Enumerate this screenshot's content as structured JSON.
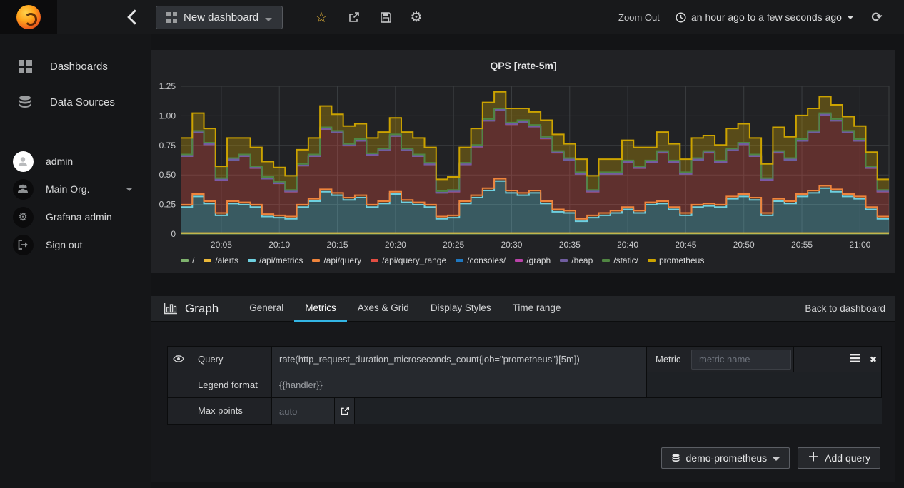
{
  "navbar": {
    "dashboard_title": "New dashboard",
    "zoom_out_label": "Zoom Out",
    "time_range_label": "an hour ago to a few seconds ago"
  },
  "sidebar": {
    "items": [
      {
        "label": "Dashboards"
      },
      {
        "label": "Data Sources"
      }
    ],
    "user_items": [
      {
        "label": "admin"
      },
      {
        "label": "Main Org."
      },
      {
        "label": "Grafana admin"
      },
      {
        "label": "Sign out"
      }
    ]
  },
  "panel": {
    "title": "QPS [rate-5m]"
  },
  "chart_data": {
    "type": "area",
    "stacked": true,
    "title": "QPS [rate-5m]",
    "x_start": "20:02",
    "x_step_minutes": 1,
    "points": 61,
    "x_domain_minutes": [
      1.5,
      62.5
    ],
    "ylim": [
      0,
      1.25
    ],
    "grid": true,
    "legend_position": "bottom",
    "fill_opacity": 0.32,
    "y_ticks": [
      {
        "label": "0",
        "v": 0
      },
      {
        "label": "0.25",
        "v": 0.25
      },
      {
        "label": "0.50",
        "v": 0.5
      },
      {
        "label": "0.75",
        "v": 0.75
      },
      {
        "label": "1.00",
        "v": 1.0
      },
      {
        "label": "1.25",
        "v": 1.25
      }
    ],
    "x_ticks": [
      {
        "label": "20:05",
        "m": 5
      },
      {
        "label": "20:10",
        "m": 10
      },
      {
        "label": "20:15",
        "m": 15
      },
      {
        "label": "20:20",
        "m": 20
      },
      {
        "label": "20:25",
        "m": 25
      },
      {
        "label": "20:30",
        "m": 30
      },
      {
        "label": "20:35",
        "m": 35
      },
      {
        "label": "20:40",
        "m": 40
      },
      {
        "label": "20:45",
        "m": 45
      },
      {
        "label": "20:50",
        "m": 50
      },
      {
        "label": "20:55",
        "m": 55
      },
      {
        "label": "21:00",
        "m": 60
      }
    ],
    "series": [
      {
        "name": "/",
        "color": "#7EB26D",
        "const": 0.004
      },
      {
        "name": "/alerts",
        "color": "#EAB839",
        "const": 0.004
      },
      {
        "name": "/api/metrics",
        "color": "#6ED0E0",
        "values": [
          0.22,
          0.31,
          0.25,
          0.15,
          0.25,
          0.24,
          0.22,
          0.14,
          0.13,
          0.12,
          0.22,
          0.27,
          0.35,
          0.32,
          0.28,
          0.3,
          0.22,
          0.25,
          0.33,
          0.26,
          0.24,
          0.22,
          0.12,
          0.13,
          0.25,
          0.3,
          0.36,
          0.44,
          0.34,
          0.32,
          0.34,
          0.25,
          0.18,
          0.17,
          0.1,
          0.13,
          0.15,
          0.17,
          0.2,
          0.17,
          0.24,
          0.25,
          0.2,
          0.15,
          0.22,
          0.23,
          0.22,
          0.29,
          0.31,
          0.28,
          0.15,
          0.27,
          0.25,
          0.31,
          0.34,
          0.38,
          0.35,
          0.31,
          0.29,
          0.2,
          0.12
        ]
      },
      {
        "name": "/api/query",
        "color": "#EF843C",
        "const": 0.02
      },
      {
        "name": "/api/query_range",
        "color": "#E24D42",
        "values": [
          0.41,
          0.52,
          0.48,
          0.28,
          0.35,
          0.39,
          0.31,
          0.3,
          0.27,
          0.21,
          0.33,
          0.36,
          0.51,
          0.51,
          0.44,
          0.46,
          0.42,
          0.43,
          0.47,
          0.42,
          0.39,
          0.34,
          0.2,
          0.2,
          0.31,
          0.41,
          0.57,
          0.58,
          0.56,
          0.6,
          0.54,
          0.53,
          0.48,
          0.43,
          0.38,
          0.2,
          0.33,
          0.31,
          0.38,
          0.36,
          0.34,
          0.41,
          0.38,
          0.33,
          0.38,
          0.43,
          0.36,
          0.39,
          0.42,
          0.35,
          0.28,
          0.39,
          0.35,
          0.45,
          0.49,
          0.6,
          0.58,
          0.52,
          0.47,
          0.33,
          0.21
        ]
      },
      {
        "name": "/consoles/",
        "color": "#1F78C1",
        "const": 0.001
      },
      {
        "name": "/graph",
        "color": "#BA43A9",
        "const": 0.001
      },
      {
        "name": "/heap",
        "color": "#705DA0",
        "const": 0.001
      },
      {
        "name": "/static/",
        "color": "#508642",
        "const": 0.012
      },
      {
        "name": "prometheus",
        "color": "#CCA300",
        "values": [
          0.14,
          0.15,
          0.12,
          0.1,
          0.17,
          0.14,
          0.16,
          0.13,
          0.12,
          0.12,
          0.12,
          0.14,
          0.18,
          0.14,
          0.15,
          0.13,
          0.13,
          0.14,
          0.14,
          0.14,
          0.14,
          0.13,
          0.1,
          0.11,
          0.13,
          0.14,
          0.14,
          0.14,
          0.12,
          0.1,
          0.11,
          0.14,
          0.14,
          0.12,
          0.11,
          0.12,
          0.11,
          0.11,
          0.17,
          0.16,
          0.11,
          0.16,
          0.14,
          0.11,
          0.17,
          0.13,
          0.13,
          0.17,
          0.16,
          0.14,
          0.12,
          0.2,
          0.18,
          0.2,
          0.19,
          0.14,
          0.12,
          0.12,
          0.11,
          0.12,
          0.09
        ]
      }
    ]
  },
  "editor": {
    "panel_type_label": "Graph",
    "tabs": [
      "General",
      "Metrics",
      "Axes & Grid",
      "Display Styles",
      "Time range"
    ],
    "active_tab": "Metrics",
    "back_link": "Back to dashboard",
    "query_row": {
      "label": "Query",
      "value": "rate(http_request_duration_microseconds_count{job=\"prometheus\"}[5m])",
      "metric_label": "Metric",
      "metric_placeholder": "metric name"
    },
    "legend_row": {
      "label": "Legend format",
      "value": "{{handler}}"
    },
    "max_points_row": {
      "label": "Max points",
      "placeholder": "auto"
    },
    "datasource_button": "demo-prometheus",
    "add_query_button": "Add query"
  },
  "colors": {
    "active_tab_underline": "#33b5e5",
    "star": "#eab839",
    "panel_bg": "#212225",
    "grid_line": "#3a3d40"
  }
}
